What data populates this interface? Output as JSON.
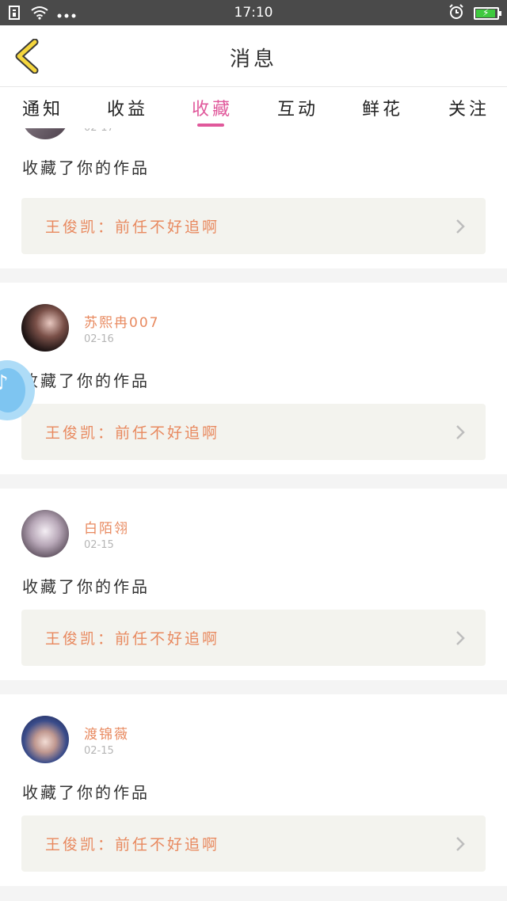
{
  "status_bar": {
    "time": "17:10"
  },
  "header": {
    "title": "消息"
  },
  "tabs": [
    {
      "label": "通知"
    },
    {
      "label": "收益"
    },
    {
      "label": "收藏"
    },
    {
      "label": "互动"
    },
    {
      "label": "鲜花"
    },
    {
      "label": "关注"
    }
  ],
  "active_tab": "收藏",
  "colors": {
    "accent": "#e0589b",
    "name_text": "#e8895f",
    "work_bg": "#f3f3ee",
    "battery_fill": "#3ec93e"
  },
  "items": [
    {
      "user": "",
      "date": "02-17",
      "action": "收藏了你的作品",
      "work": "王俊凯：前任不好追啊"
    },
    {
      "user": "苏熙冉007",
      "date": "02-16",
      "action": "收藏了你的作品",
      "work": "王俊凯：前任不好追啊"
    },
    {
      "user": "白陌翎",
      "date": "02-15",
      "action": "收藏了你的作品",
      "work": "王俊凯：前任不好追啊"
    },
    {
      "user": "渡锦薇",
      "date": "02-15",
      "action": "收藏了你的作品",
      "work": "王俊凯：前任不好追啊"
    }
  ]
}
